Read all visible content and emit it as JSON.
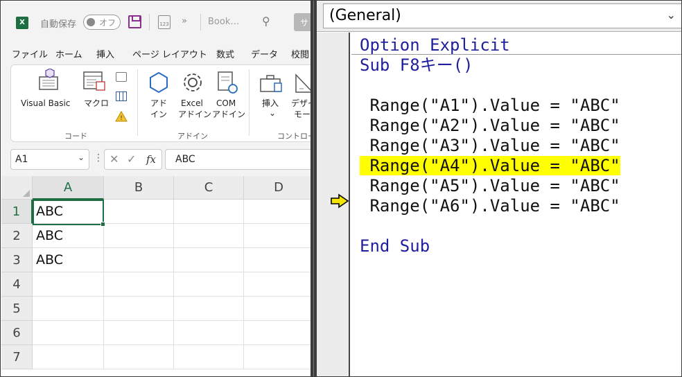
{
  "excel": {
    "autosave_label": "自動保存",
    "autosave_state": "オフ",
    "book_name": "Book…",
    "user_initial": "サ",
    "more_glyph": "»",
    "form_icon_text": "123",
    "menu": [
      "ファイル",
      "ホーム",
      "挿入",
      "ページ レイアウト",
      "数式",
      "データ",
      "校閲"
    ],
    "ribbon": {
      "visual_basic": "Visual Basic",
      "macro": "マクロ",
      "addin_line1": "アド",
      "addin_line2": "イン",
      "excel_addin_line1": "Excel",
      "excel_addin_line2": "アドイン",
      "com_addin_line1": "COM",
      "com_addin_line2": "アドイン",
      "insert": "挿入",
      "insert_chev": "⌄",
      "design_line1": "デザイ",
      "design_line2": "モー",
      "group_code": "コード",
      "group_addin": "アドイン",
      "group_control": "コントロー"
    },
    "name_box": "A1",
    "formula_value": "ABC",
    "fx_label": "fx",
    "columns": [
      "A",
      "B",
      "C",
      "D"
    ],
    "rows": [
      "1",
      "2",
      "3",
      "4",
      "5",
      "6",
      "7"
    ],
    "cells": {
      "A1": "ABC",
      "A2": "ABC",
      "A3": "ABC"
    }
  },
  "vba": {
    "object_combo": "(General)",
    "code_lines": [
      {
        "text": "Option Explicit",
        "kind": "keyword"
      },
      {
        "text": "Sub F8キー()",
        "kind": "keyword"
      },
      {
        "text": "",
        "kind": "plain"
      },
      {
        "text": " Range(\"A1\").Value = \"ABC\"",
        "kind": "plain"
      },
      {
        "text": " Range(\"A2\").Value = \"ABC\"",
        "kind": "plain"
      },
      {
        "text": " Range(\"A3\").Value = \"ABC\"",
        "kind": "plain"
      },
      {
        "text": " Range(\"A4\").Value = \"ABC\"",
        "kind": "current"
      },
      {
        "text": " Range(\"A5\").Value = \"ABC\"",
        "kind": "plain"
      },
      {
        "text": " Range(\"A6\").Value = \"ABC\"",
        "kind": "plain"
      },
      {
        "text": "",
        "kind": "plain"
      },
      {
        "text": "End Sub",
        "kind": "keyword"
      }
    ],
    "colors": {
      "keyword": "#1f1f9e",
      "current_line_highlight": "#ffff00",
      "execution_arrow": "#f5e400"
    }
  }
}
